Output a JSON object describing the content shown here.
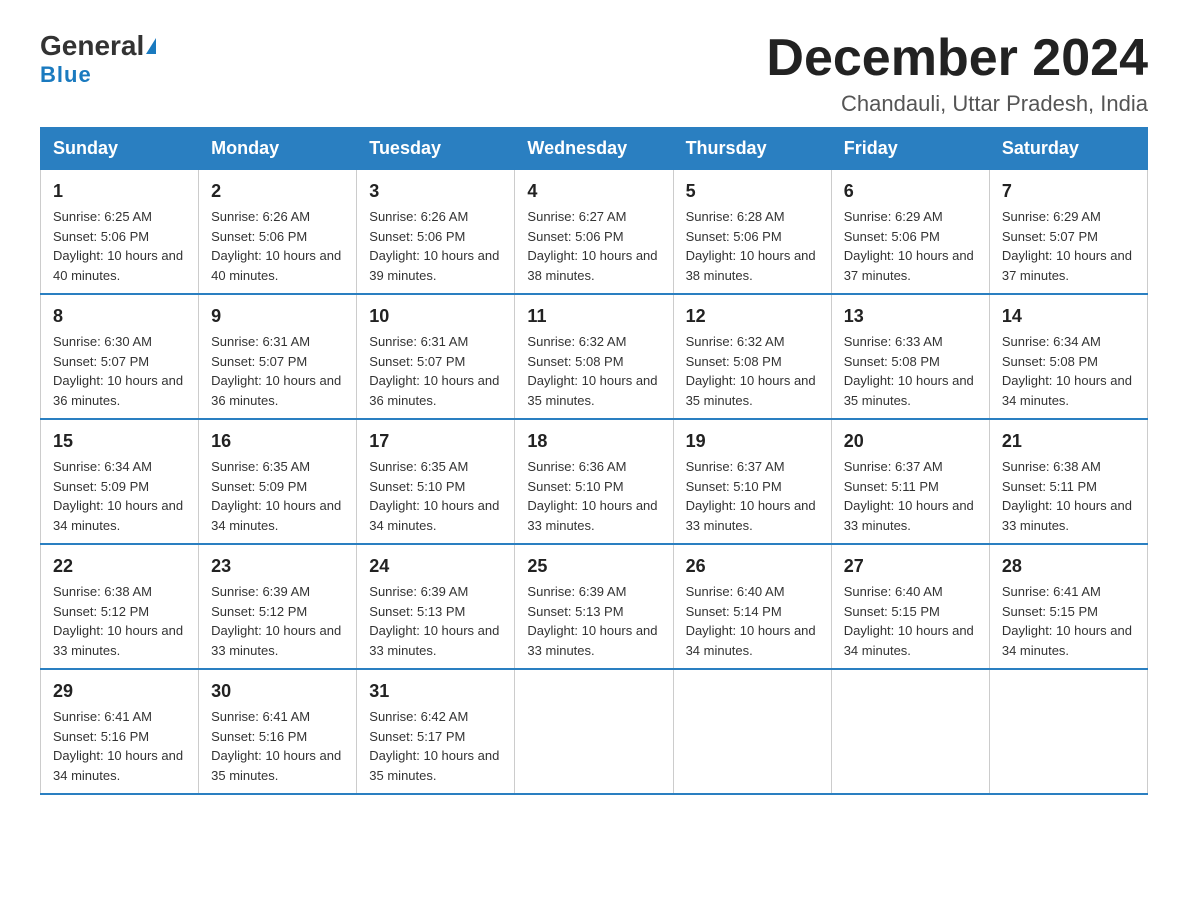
{
  "logo": {
    "general": "General",
    "blue": "Blue"
  },
  "header": {
    "month_year": "December 2024",
    "location": "Chandauli, Uttar Pradesh, India"
  },
  "columns": [
    "Sunday",
    "Monday",
    "Tuesday",
    "Wednesday",
    "Thursday",
    "Friday",
    "Saturday"
  ],
  "weeks": [
    [
      {
        "day": "1",
        "sunrise": "6:25 AM",
        "sunset": "5:06 PM",
        "daylight": "10 hours and 40 minutes."
      },
      {
        "day": "2",
        "sunrise": "6:26 AM",
        "sunset": "5:06 PM",
        "daylight": "10 hours and 40 minutes."
      },
      {
        "day": "3",
        "sunrise": "6:26 AM",
        "sunset": "5:06 PM",
        "daylight": "10 hours and 39 minutes."
      },
      {
        "day": "4",
        "sunrise": "6:27 AM",
        "sunset": "5:06 PM",
        "daylight": "10 hours and 38 minutes."
      },
      {
        "day": "5",
        "sunrise": "6:28 AM",
        "sunset": "5:06 PM",
        "daylight": "10 hours and 38 minutes."
      },
      {
        "day": "6",
        "sunrise": "6:29 AM",
        "sunset": "5:06 PM",
        "daylight": "10 hours and 37 minutes."
      },
      {
        "day": "7",
        "sunrise": "6:29 AM",
        "sunset": "5:07 PM",
        "daylight": "10 hours and 37 minutes."
      }
    ],
    [
      {
        "day": "8",
        "sunrise": "6:30 AM",
        "sunset": "5:07 PM",
        "daylight": "10 hours and 36 minutes."
      },
      {
        "day": "9",
        "sunrise": "6:31 AM",
        "sunset": "5:07 PM",
        "daylight": "10 hours and 36 minutes."
      },
      {
        "day": "10",
        "sunrise": "6:31 AM",
        "sunset": "5:07 PM",
        "daylight": "10 hours and 36 minutes."
      },
      {
        "day": "11",
        "sunrise": "6:32 AM",
        "sunset": "5:08 PM",
        "daylight": "10 hours and 35 minutes."
      },
      {
        "day": "12",
        "sunrise": "6:32 AM",
        "sunset": "5:08 PM",
        "daylight": "10 hours and 35 minutes."
      },
      {
        "day": "13",
        "sunrise": "6:33 AM",
        "sunset": "5:08 PM",
        "daylight": "10 hours and 35 minutes."
      },
      {
        "day": "14",
        "sunrise": "6:34 AM",
        "sunset": "5:08 PM",
        "daylight": "10 hours and 34 minutes."
      }
    ],
    [
      {
        "day": "15",
        "sunrise": "6:34 AM",
        "sunset": "5:09 PM",
        "daylight": "10 hours and 34 minutes."
      },
      {
        "day": "16",
        "sunrise": "6:35 AM",
        "sunset": "5:09 PM",
        "daylight": "10 hours and 34 minutes."
      },
      {
        "day": "17",
        "sunrise": "6:35 AM",
        "sunset": "5:10 PM",
        "daylight": "10 hours and 34 minutes."
      },
      {
        "day": "18",
        "sunrise": "6:36 AM",
        "sunset": "5:10 PM",
        "daylight": "10 hours and 33 minutes."
      },
      {
        "day": "19",
        "sunrise": "6:37 AM",
        "sunset": "5:10 PM",
        "daylight": "10 hours and 33 minutes."
      },
      {
        "day": "20",
        "sunrise": "6:37 AM",
        "sunset": "5:11 PM",
        "daylight": "10 hours and 33 minutes."
      },
      {
        "day": "21",
        "sunrise": "6:38 AM",
        "sunset": "5:11 PM",
        "daylight": "10 hours and 33 minutes."
      }
    ],
    [
      {
        "day": "22",
        "sunrise": "6:38 AM",
        "sunset": "5:12 PM",
        "daylight": "10 hours and 33 minutes."
      },
      {
        "day": "23",
        "sunrise": "6:39 AM",
        "sunset": "5:12 PM",
        "daylight": "10 hours and 33 minutes."
      },
      {
        "day": "24",
        "sunrise": "6:39 AM",
        "sunset": "5:13 PM",
        "daylight": "10 hours and 33 minutes."
      },
      {
        "day": "25",
        "sunrise": "6:39 AM",
        "sunset": "5:13 PM",
        "daylight": "10 hours and 33 minutes."
      },
      {
        "day": "26",
        "sunrise": "6:40 AM",
        "sunset": "5:14 PM",
        "daylight": "10 hours and 34 minutes."
      },
      {
        "day": "27",
        "sunrise": "6:40 AM",
        "sunset": "5:15 PM",
        "daylight": "10 hours and 34 minutes."
      },
      {
        "day": "28",
        "sunrise": "6:41 AM",
        "sunset": "5:15 PM",
        "daylight": "10 hours and 34 minutes."
      }
    ],
    [
      {
        "day": "29",
        "sunrise": "6:41 AM",
        "sunset": "5:16 PM",
        "daylight": "10 hours and 34 minutes."
      },
      {
        "day": "30",
        "sunrise": "6:41 AM",
        "sunset": "5:16 PM",
        "daylight": "10 hours and 35 minutes."
      },
      {
        "day": "31",
        "sunrise": "6:42 AM",
        "sunset": "5:17 PM",
        "daylight": "10 hours and 35 minutes."
      },
      null,
      null,
      null,
      null
    ]
  ],
  "labels": {
    "sunrise": "Sunrise:",
    "sunset": "Sunset:",
    "daylight": "Daylight:"
  }
}
